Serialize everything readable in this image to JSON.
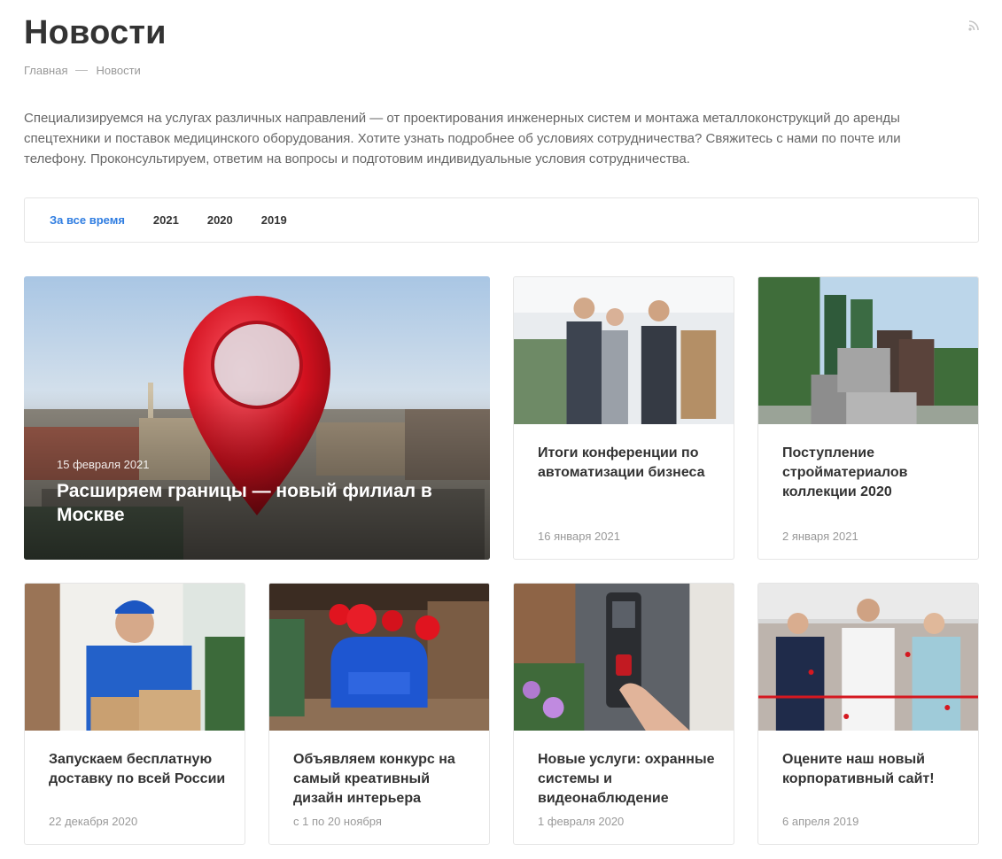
{
  "page": {
    "title": "Новости"
  },
  "breadcrumb": {
    "home": "Главная",
    "current": "Новости"
  },
  "intro": "Специализируемся на услугах различных направлений — от проектирования инженерных систем и монтажа металлоконструкций до аренды спецтехники и поставок медицинского оборудования. Хотите узнать подробнее об условиях сотрудничества? Свяжитесь с нами по почте или телефону. Проконсультируем, ответим на вопросы и подготовим индивидуальные условия сотрудничества.",
  "filters": {
    "all": "За все время",
    "y2021": "2021",
    "y2020": "2020",
    "y2019": "2019"
  },
  "colors": {
    "accent": "#2f7de1",
    "text": "#333333",
    "muted": "#999999",
    "border": "#e5e5e5"
  },
  "news": {
    "featured": {
      "date": "15 февраля 2021",
      "title": "Расширяем границы — новый филиал в Москве"
    },
    "items": [
      {
        "title": "Итоги конференции по автоматизации бизнеса",
        "date": "16 января 2021"
      },
      {
        "title": "Поступление стройматериалов коллекции 2020",
        "date": "2 января 2021"
      },
      {
        "title": "Запускаем бесплатную доставку по всей России",
        "date": "22 декабря 2020"
      },
      {
        "title": "Объявляем конкурс на самый креативный дизайн интерьера",
        "date": "с 1 по 20 ноября"
      },
      {
        "title": "Новые услуги: охранные системы и видеонаблюдение",
        "date": "1 февраля 2020"
      },
      {
        "title": "Оцените наш новый корпоративный сайт!",
        "date": "6 апреля 2019"
      }
    ]
  }
}
